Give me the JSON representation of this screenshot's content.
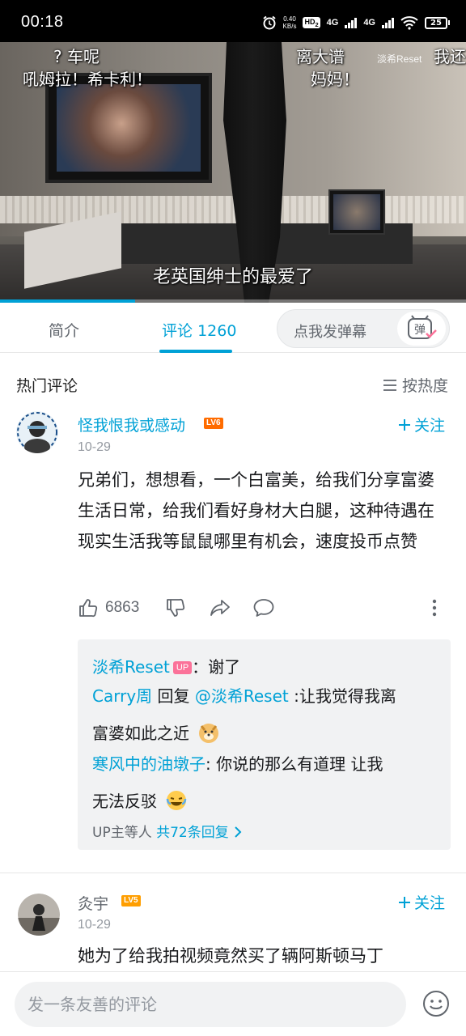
{
  "status_bar": {
    "time": "00:18",
    "net_speed_value": "0.40",
    "net_speed_unit": "KB/s",
    "hd": "HD",
    "hd_num": "2",
    "signal1": "4G",
    "signal2": "4G",
    "battery": "25"
  },
  "video": {
    "danmaku": [
      "? 车呢",
      "吼姆拉！希卡利！",
      "离大谱",
      "妈妈！",
      "我还"
    ],
    "watermark": "淡希Reset",
    "subtitle": "老英国绅士的最爱了",
    "progress": 0.29
  },
  "tabs": {
    "intro": "简介",
    "comments": "评论",
    "comments_count": "1260",
    "danmaku_placeholder": "点我发弹幕",
    "danmaku_icon_char": "弹"
  },
  "comments_section": {
    "title": "热门评论",
    "sort_label": "按热度"
  },
  "comments": [
    {
      "username": "怪我恨我或感动",
      "level": "LV6",
      "date": "10-29",
      "follow": "关注",
      "text": "兄弟们，想想看，一个白富美，给我们分享富婆生活日常，给我们看好身材大白腿，这种待遇在现实生活我等鼠鼠哪里有机会，速度投币点赞",
      "likes": "6863",
      "replies": [
        {
          "user": "淡希Reset",
          "badge": "UP",
          "text": "：谢了"
        },
        {
          "user": "Carry周",
          "action": " 回复 ",
          "mention": "@淡希Reset",
          "text": " :让我觉得我离"
        },
        {
          "text": "富婆如此之近"
        },
        {
          "user": "寒风中的油墩子",
          "text": ": 你说的那么有道理 让我"
        },
        {
          "text": "无法反驳"
        }
      ],
      "reply_summary_prefix": "UP主等人",
      "reply_summary_count": "共72条回复"
    },
    {
      "username": "灸宇",
      "level": "LV5",
      "date": "10-29",
      "follow": "关注",
      "text": "她为了给我拍视频竟然买了辆阿斯顿马丁"
    }
  ],
  "bottom_bar": {
    "input_placeholder": "发一条友善的评论"
  },
  "colors": {
    "accent": "#00a1d6",
    "lv6": "#ff6c00",
    "lv5": "#ff9e00",
    "up_badge": "#fb7299"
  }
}
